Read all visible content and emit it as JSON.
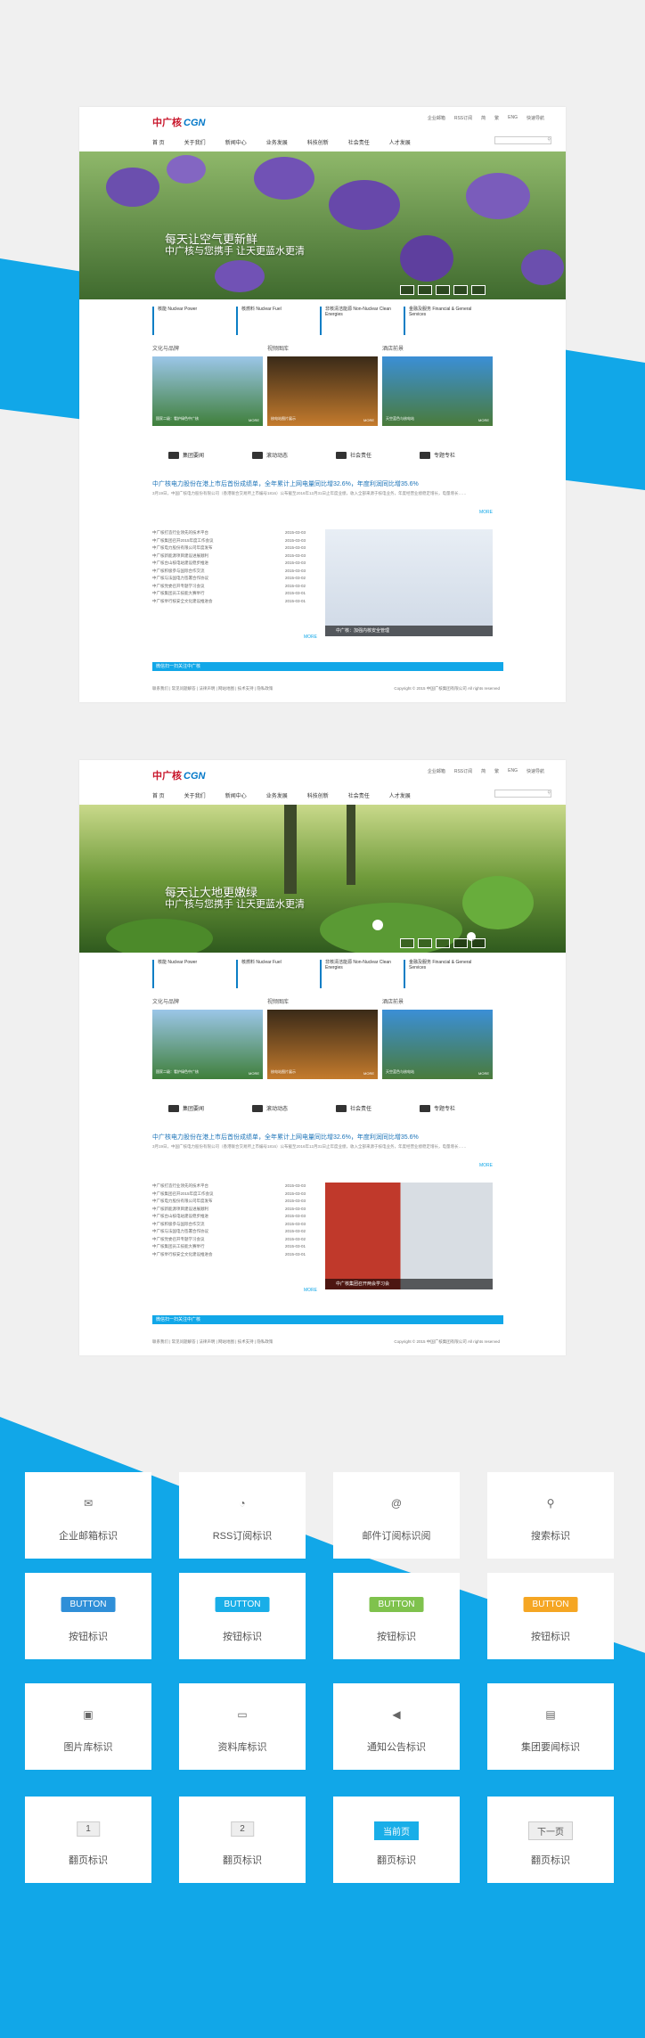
{
  "colors": {
    "brand_blue": "#11a7e8",
    "logo_red": "#c8162b",
    "logo_blue": "#0077c8"
  },
  "mockups": [
    {
      "logo_cn": "中广核",
      "logo_en": "CGN",
      "toplinks": [
        "企业邮箱",
        "RSS订阅",
        "简",
        "繁",
        "ENG",
        "快速导航"
      ],
      "nav": [
        "首 页",
        "关于我们",
        "新闻中心",
        "业务发展",
        "科技创新",
        "社会责任",
        "人才发展"
      ],
      "hero_title": "每天让空气更新鲜",
      "hero_sub": "中广核与您携手 让天更蓝水更清",
      "biz": [
        "核能 Nuclear Power",
        "核燃料 Nuclear Fuel",
        "非核清洁能源 Non-Nuclear Clean Energies",
        "金融及服务 Financial & General Services"
      ],
      "sections": [
        "文化与品牌",
        "视频图库",
        "酒店前景"
      ],
      "photo_caps": [
        "国家二级：看护绿色中广核",
        "核电站图片展示",
        "天空蓝色与核电站"
      ],
      "photo_more": "MORE",
      "icons": [
        "集团要闻",
        "滚动动态",
        "社会责任",
        "专题专栏"
      ],
      "headline": "中广核电力股份在港上市后首份成绩单，全年累计上网电量同比增32.6%，年度利润同比增35.6%",
      "summary": "3月19日，中国广核电力股份有限公司（香港联合交易所上市编号1816）公布截至2016年12月31日止年度业绩，收入全部来源于核电业务，年度经营业绩稳定增长，电量增长……",
      "more": "MORE",
      "news": [
        [
          "中广核打造行业领先的技术平台",
          "2015-03-03"
        ],
        [
          "中广核集团召开2015年度工作会议",
          "2015-03-03"
        ],
        [
          "中广核电力股份有限公司年度发布",
          "2015-03-03"
        ],
        [
          "中广核新能源项目建设进展顺利",
          "2015-03-03"
        ],
        [
          "中广核台山核电站建设稳步推进",
          "2015-03-03"
        ],
        [
          "中广核积极参与国际合作交流",
          "2015-03-03"
        ],
        [
          "中广核与法国电力签署合作协议",
          "2015-03-02"
        ],
        [
          "中广核党委召开专题学习会议",
          "2015-03-02"
        ],
        [
          "中广核集团员工技能大赛举行",
          "2015-03-01"
        ],
        [
          "中广核举行核安全文化建设推进会",
          "2015-03-01"
        ]
      ],
      "box_caption": "中广核：加强内核安全管理",
      "footer_title": "微信扫一扫关注中广核",
      "footer_links": "联系我们 | 常见问题解答 | 法律声明 | 网站地图 | 技术支持 | 隐私政策",
      "copyright": "Copyright © 2015 中国广核集团有限公司 All rights reserved"
    },
    {
      "hero_title": "每天让大地更嫩绿",
      "hero_sub": "中广核与您携手 让天更蓝水更清",
      "box_caption": "中广核集团召开两会学习会",
      "icons": [
        "集团要闻",
        "滚动动态",
        "社会责任",
        "专题专栏"
      ]
    }
  ],
  "kit": [
    {
      "type": "icon",
      "icon": "envelope-icon",
      "glyph": "✉",
      "label": "企业邮箱标识"
    },
    {
      "type": "icon",
      "icon": "rss-icon",
      "glyph": "◔",
      "label": "RSS订阅标识"
    },
    {
      "type": "icon",
      "icon": "at-icon",
      "glyph": "@",
      "label": "邮件订阅标识阅"
    },
    {
      "type": "icon",
      "icon": "search-icon",
      "glyph": "⚲",
      "label": "搜索标识"
    },
    {
      "type": "btn",
      "text": "BUTTON",
      "bg": "#2f8fd8",
      "fg": "#ffffff",
      "label": "按钮标识"
    },
    {
      "type": "btn",
      "text": "BUTTON",
      "bg": "#19aee8",
      "fg": "#ffffff",
      "label": "按钮标识"
    },
    {
      "type": "btn",
      "text": "BUTTON",
      "bg": "#7fc24d",
      "fg": "#ffffff",
      "label": "按钮标识"
    },
    {
      "type": "btn",
      "text": "BUTTON",
      "bg": "#f5a623",
      "fg": "#ffffff",
      "label": "按钮标识"
    },
    {
      "type": "icon",
      "icon": "image-icon",
      "glyph": "▣",
      "label": "图片库标识"
    },
    {
      "type": "icon",
      "icon": "folder-icon",
      "glyph": "▭",
      "label": "资料库标识"
    },
    {
      "type": "icon",
      "icon": "speaker-icon",
      "glyph": "◀",
      "label": "通知公告标识"
    },
    {
      "type": "icon",
      "icon": "newspaper-icon",
      "glyph": "▤",
      "label": "集团要闻标识"
    },
    {
      "type": "page",
      "text": "1",
      "label": "翻页标识"
    },
    {
      "type": "page",
      "text": "2",
      "label": "翻页标识"
    },
    {
      "type": "page-active",
      "text": "当前页",
      "label": "翻页标识"
    },
    {
      "type": "page",
      "text": "下一页",
      "label": "翻页标识"
    }
  ]
}
